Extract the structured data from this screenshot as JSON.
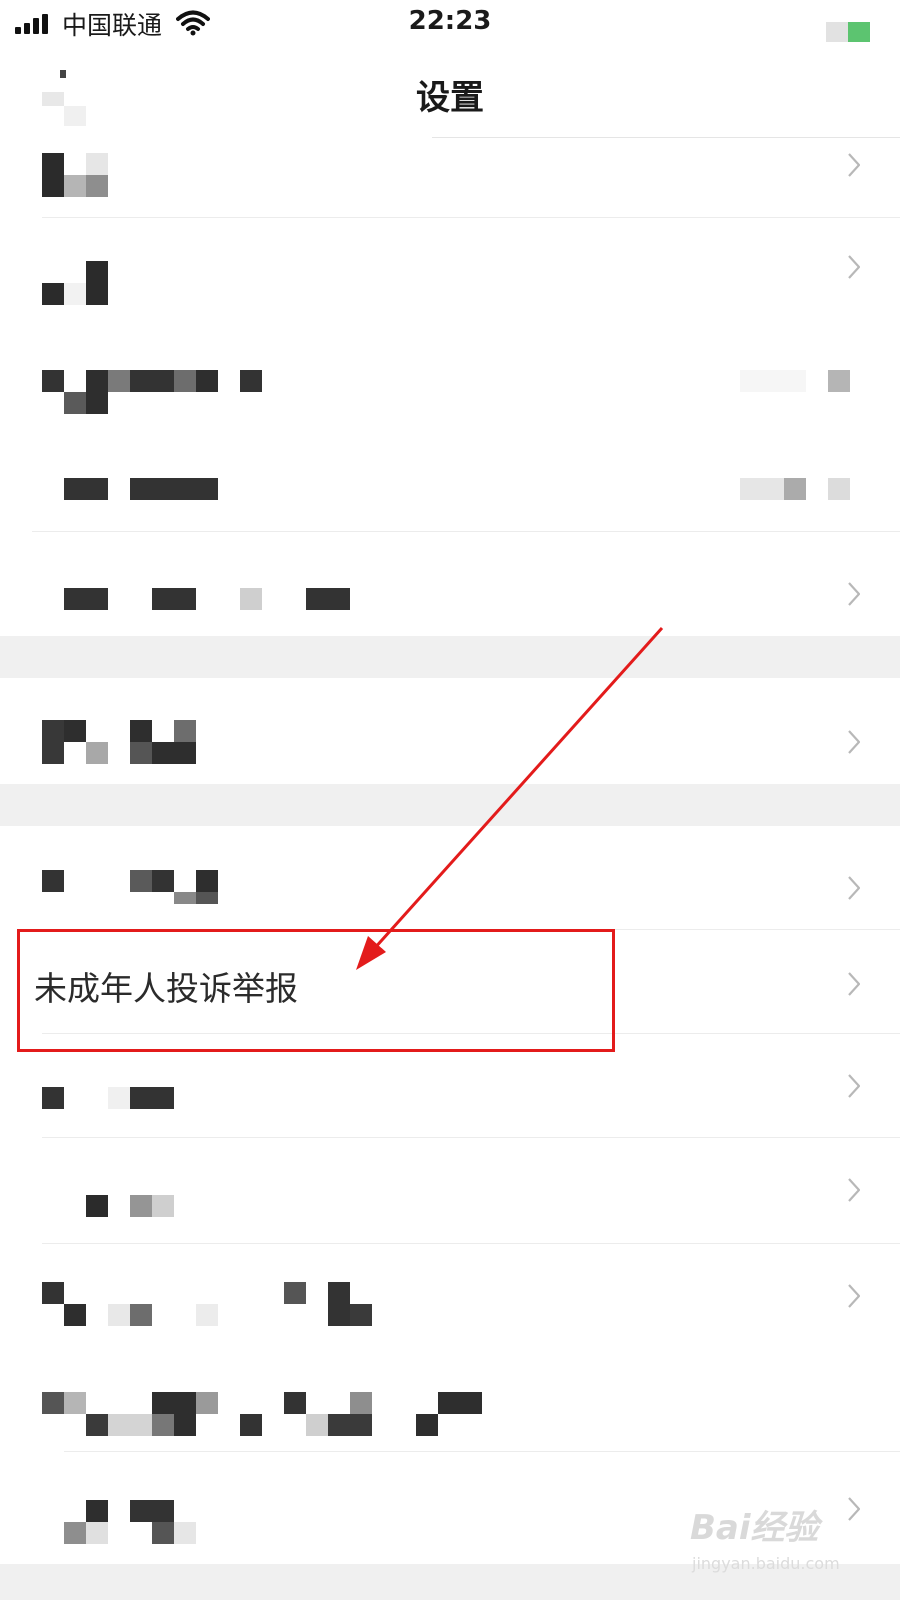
{
  "status_bar": {
    "carrier": "中国联通",
    "time": "22:23"
  },
  "nav": {
    "title": "设置"
  },
  "highlighted_row": {
    "label": "未成年人投诉举报"
  },
  "watermark": {
    "brand": "Bai经验",
    "url": "jingyan.baidu.com"
  },
  "colors": {
    "annotation": "#e31b1b",
    "battery": "#5cc470",
    "section_gap": "#f0f0f0"
  },
  "icons": [
    "signal-icon",
    "wifi-icon",
    "battery-icon",
    "chevron-right-icon",
    "back-icon"
  ]
}
